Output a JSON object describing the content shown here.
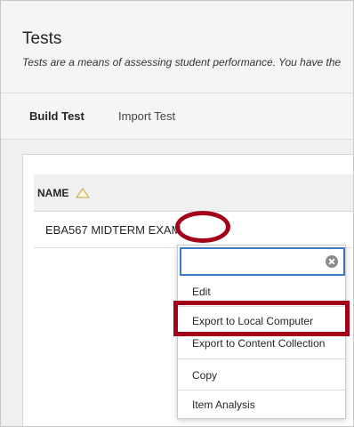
{
  "header": {
    "title": "Tests",
    "description": "Tests are a means of assessing student performance. You have the"
  },
  "tabs": [
    {
      "label": "Build Test",
      "active": true
    },
    {
      "label": "Import Test",
      "active": false
    }
  ],
  "table": {
    "column_header": "NAME",
    "rows": [
      {
        "name": "EBA567 MIDTERM EXAM"
      }
    ]
  },
  "context_menu": {
    "search_value": "",
    "items": [
      {
        "label": "Edit"
      },
      {
        "label": "Export to Local Computer"
      },
      {
        "label": "Export to Content Collection"
      },
      {
        "label": "Copy"
      },
      {
        "label": "Item Analysis"
      }
    ]
  },
  "icons": {
    "sort": "sort-ascending-icon",
    "clear": "clear-icon"
  },
  "colors": {
    "highlight": "#a3001a",
    "focus_border": "#3c7bc3"
  }
}
